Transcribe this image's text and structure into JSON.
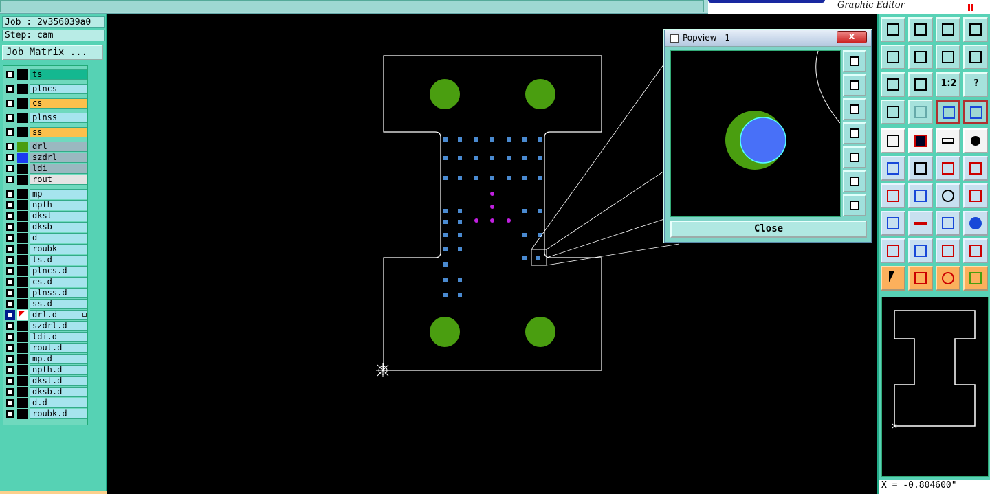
{
  "app": {
    "subtitle": "Graphic Editor"
  },
  "job": {
    "job_label": "Job : 2v356039a0",
    "step_label": "Step: cam",
    "matrix_button": "Job Matrix ..."
  },
  "layers": [
    {
      "name": "ts",
      "color": "#000000"
    },
    {
      "name": "plncs",
      "color": "#000000"
    },
    {
      "name": "cs",
      "color": "#000000"
    },
    {
      "name": "plnss",
      "color": "#000000"
    },
    {
      "name": "ss",
      "color": "#000000"
    },
    {
      "name": "drl",
      "color": "#4a9e10"
    },
    {
      "name": "szdrl",
      "color": "#1a3cf0"
    },
    {
      "name": "ldi",
      "color": "#000000"
    },
    {
      "name": "rout",
      "color": "#000000"
    },
    {
      "name": "mp",
      "color": "#000000"
    },
    {
      "name": "npth",
      "color": "#000000"
    },
    {
      "name": "dkst",
      "color": "#000000"
    },
    {
      "name": "dksb",
      "color": "#000000"
    },
    {
      "name": "d",
      "color": "#000000"
    },
    {
      "name": "roubk",
      "color": "#000000"
    },
    {
      "name": "ts.d",
      "color": "#000000"
    },
    {
      "name": "plncs.d",
      "color": "#000000"
    },
    {
      "name": "cs.d",
      "color": "#000000"
    },
    {
      "name": "plnss.d",
      "color": "#000000"
    },
    {
      "name": "ss.d",
      "color": "#000000"
    },
    {
      "name": "drl.d",
      "color": "#ffffff"
    },
    {
      "name": "szdrl.d",
      "color": "#000000"
    },
    {
      "name": "ldi.d",
      "color": "#000000"
    },
    {
      "name": "rout.d",
      "color": "#000000"
    },
    {
      "name": "mp.d",
      "color": "#000000"
    },
    {
      "name": "npth.d",
      "color": "#000000"
    },
    {
      "name": "dkst.d",
      "color": "#000000"
    },
    {
      "name": "dksb.d",
      "color": "#000000"
    },
    {
      "name": "d.d",
      "color": "#000000"
    },
    {
      "name": "roubk.d",
      "color": "#000000"
    }
  ],
  "popview": {
    "title": "Popview - 1",
    "close_x": "x",
    "close_button": "Close"
  },
  "toolbar": {
    "scale_label": "1:2",
    "help_label": "?"
  },
  "status": {
    "x_coord": "X = -0.804600\""
  },
  "colors": {
    "outline": "#ffffff",
    "pad_green": "#4a9e10",
    "pad_blue": "#4a8ad0",
    "pad_magenta": "#c020e0",
    "highlight_blue": "#4870f8"
  }
}
